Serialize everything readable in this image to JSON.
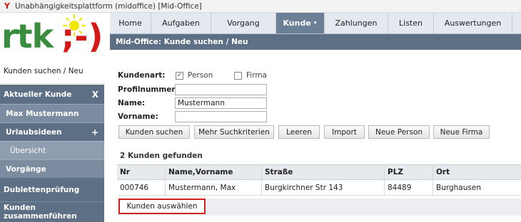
{
  "window": {
    "title": "Unabhängigkeitsplattform (midoffice)  [Mid-Office]",
    "app_icon": "Y"
  },
  "logo": {
    "text": "rtk",
    "suffix": ";-)"
  },
  "nav": {
    "tabs": [
      {
        "label": "Home"
      },
      {
        "label": "Aufgaben"
      },
      {
        "label": "Vorgang"
      },
      {
        "label": "Kunde",
        "active": true,
        "marker": "•"
      },
      {
        "label": "Zahlungen"
      },
      {
        "label": "Listen"
      },
      {
        "label": "Auswertungen"
      }
    ]
  },
  "breadcrumb": "Mid-Office: Kunde suchen / Neu",
  "sidebar": {
    "search_new": "Kunden suchen / Neu",
    "current_customer": "Aktueller Kunde",
    "close": "X",
    "customer_name": "Max Mustermann",
    "holiday_ideas": "Urlaubsideen",
    "add": "+",
    "overview": "Übersicht",
    "processes": "Vorgänge",
    "duplicate_check": "Dublettenprüfung",
    "merge_customers": "Kunden zusammenführen"
  },
  "form": {
    "customer_type_label": "Kundenart:",
    "person_label": "Person",
    "person_checked": true,
    "company_label": "Firma",
    "company_checked": false,
    "profile_label": "Profilnummer:",
    "profile_value": "",
    "name_label": "Name:",
    "name_value": "Mustermann",
    "firstname_label": "Vorname:",
    "firstname_value": "",
    "check_mark": "✓"
  },
  "buttons": {
    "search": "Kunden suchen",
    "more_criteria": "Mehr Suchkriterien",
    "clear": "Leeren",
    "import": "Import",
    "new_person": "Neue Person",
    "new_company": "Neue Firma"
  },
  "results": {
    "title": "2 Kunden gefunden",
    "columns": [
      "Nr",
      "Name,Vorname",
      "Straße",
      "PLZ",
      "Ort"
    ],
    "rows": [
      [
        "000746",
        "Mustermann, Max",
        "Burgkirchner Str 143",
        "84489",
        "Burghausen"
      ]
    ],
    "select_button": "Kunden auswählen"
  }
}
